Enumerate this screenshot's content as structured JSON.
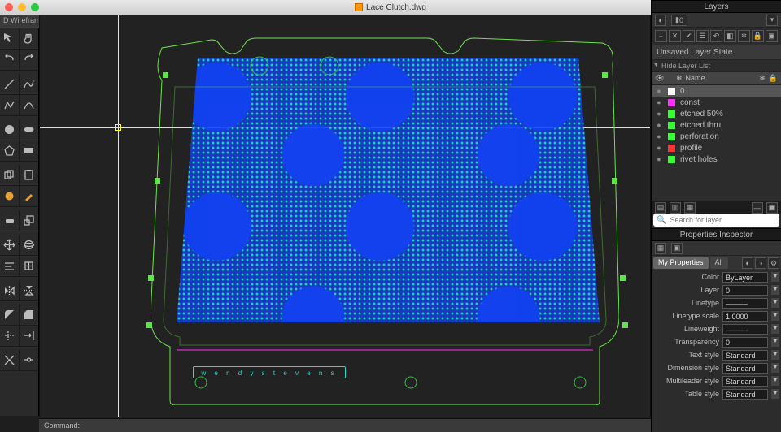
{
  "titlebar": {
    "filename": "Lace Clutch.dwg"
  },
  "wirebar_label": "D Wireframe",
  "canvas": {
    "signature": "w e n d y  s t e v e n s"
  },
  "layers_panel": {
    "title": "Layers",
    "group_value": "0",
    "state_label": "Unsaved Layer State",
    "hide_label": "Hide Layer List",
    "header": "Name",
    "items": [
      {
        "name": "0",
        "color": "#ffffff",
        "selected": true
      },
      {
        "name": "const",
        "color": "#ff33ff",
        "selected": false
      },
      {
        "name": "etched 50%",
        "color": "#33ff33",
        "selected": false
      },
      {
        "name": "etched thru",
        "color": "#33ff33",
        "selected": false
      },
      {
        "name": "perforation",
        "color": "#33ff33",
        "selected": false
      },
      {
        "name": "profile",
        "color": "#ff3333",
        "selected": false
      },
      {
        "name": "rivet holes",
        "color": "#33ff33",
        "selected": false
      }
    ],
    "search_placeholder": "Search for layer"
  },
  "props_panel": {
    "title": "Properties Inspector",
    "tabs": {
      "my": "My Properties",
      "all": "All"
    },
    "rows": [
      {
        "label": "Color",
        "value": "ByLayer"
      },
      {
        "label": "Layer",
        "value": "0"
      },
      {
        "label": "Linetype",
        "value": "———"
      },
      {
        "label": "Linetype scale",
        "value": "1.0000"
      },
      {
        "label": "Lineweight",
        "value": "———"
      },
      {
        "label": "Transparency",
        "value": "0"
      },
      {
        "label": "Text style",
        "value": "Standard"
      },
      {
        "label": "Dimension style",
        "value": "Standard"
      },
      {
        "label": "Multileader style",
        "value": "Standard"
      },
      {
        "label": "Table style",
        "value": "Standard"
      }
    ]
  },
  "cmdline": {
    "prompt": "Command:"
  },
  "tool_groups": [
    [
      "move",
      "hand"
    ],
    [
      "undo",
      "redo"
    ],
    [],
    [
      "line",
      "spline"
    ],
    [
      "polyline",
      "arc"
    ],
    [],
    [
      "circle",
      "ellipse"
    ],
    [
      "polygon",
      "rectangle"
    ],
    [],
    [
      "copy",
      "paste"
    ],
    [
      "color",
      "brush"
    ],
    [],
    [
      "eraser",
      "scale"
    ],
    [],
    [
      "pan-cross",
      "orbit"
    ],
    [
      "align",
      "snap"
    ],
    [],
    [
      "mirror",
      "mirror-v"
    ],
    [],
    [
      "fillet",
      "chamfer"
    ],
    [
      "trim",
      "extend"
    ],
    [],
    [
      "explode",
      "join"
    ]
  ]
}
